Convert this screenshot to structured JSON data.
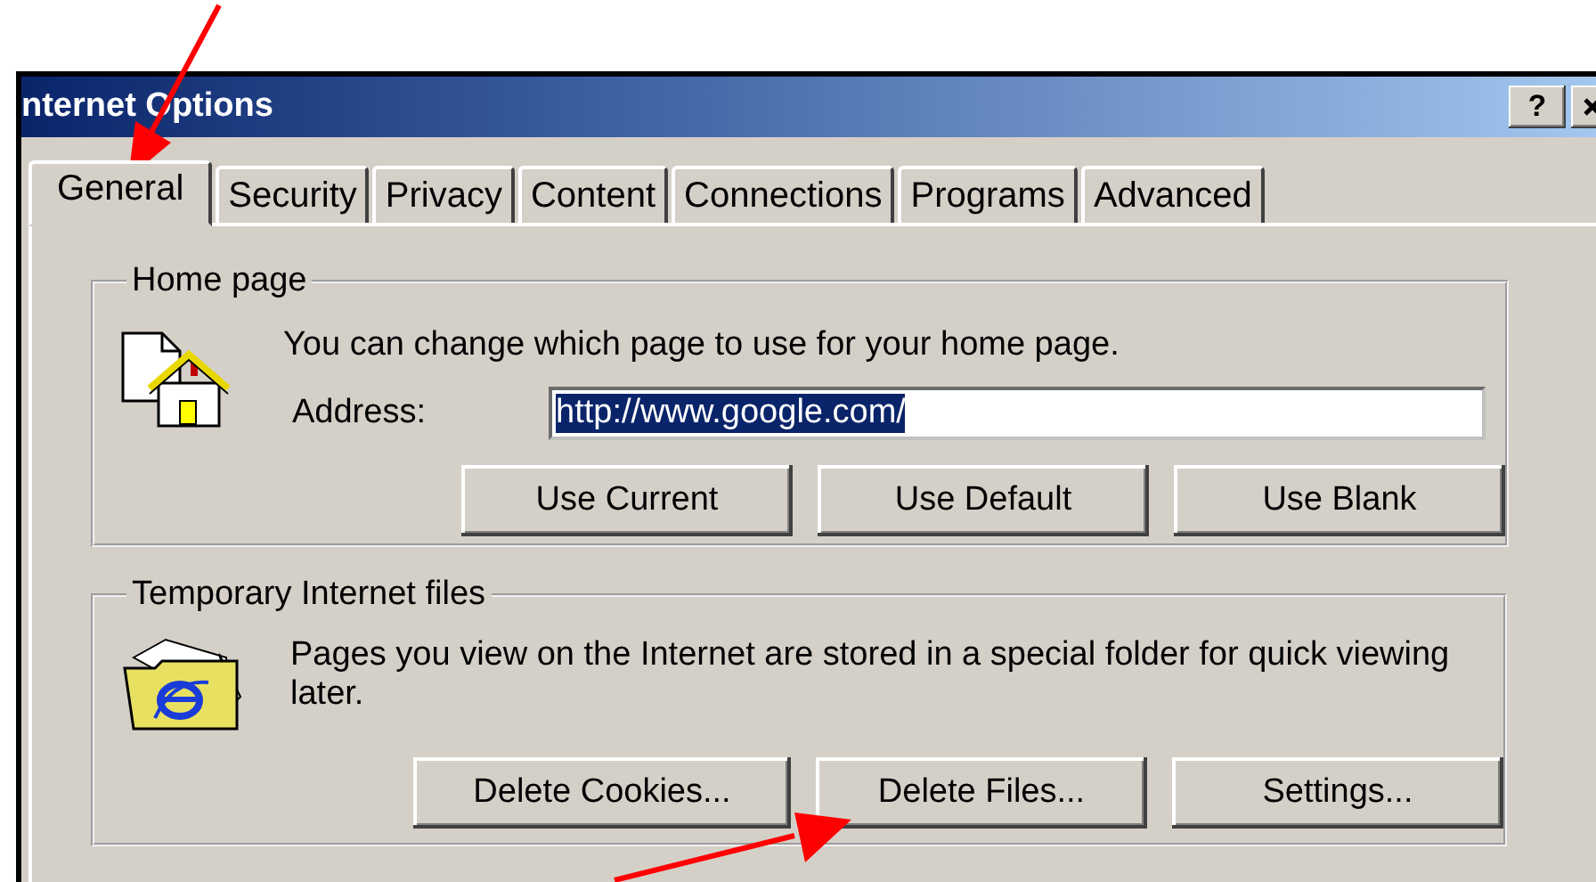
{
  "window": {
    "title": "nternet Options",
    "help_button": "?"
  },
  "tabs": [
    {
      "label": "General",
      "selected": true
    },
    {
      "label": "Security",
      "selected": false
    },
    {
      "label": "Privacy",
      "selected": false
    },
    {
      "label": "Content",
      "selected": false
    },
    {
      "label": "Connections",
      "selected": false
    },
    {
      "label": "Programs",
      "selected": false
    },
    {
      "label": "Advanced",
      "selected": false
    }
  ],
  "home_page": {
    "title": "Home page",
    "description": "You can change which page to use for your home page.",
    "address_label": "Address:",
    "address_value": "http://www.google.com/",
    "address_highlighted": true,
    "buttons": [
      "Use Current",
      "Use Default",
      "Use Blank"
    ]
  },
  "temporary_files": {
    "title": "Temporary Internet files",
    "description": "Pages you view on the Internet are stored in a special folder for quick viewing later.",
    "buttons": [
      "Delete Cookies...",
      "Delete Files...",
      "Settings..."
    ]
  }
}
